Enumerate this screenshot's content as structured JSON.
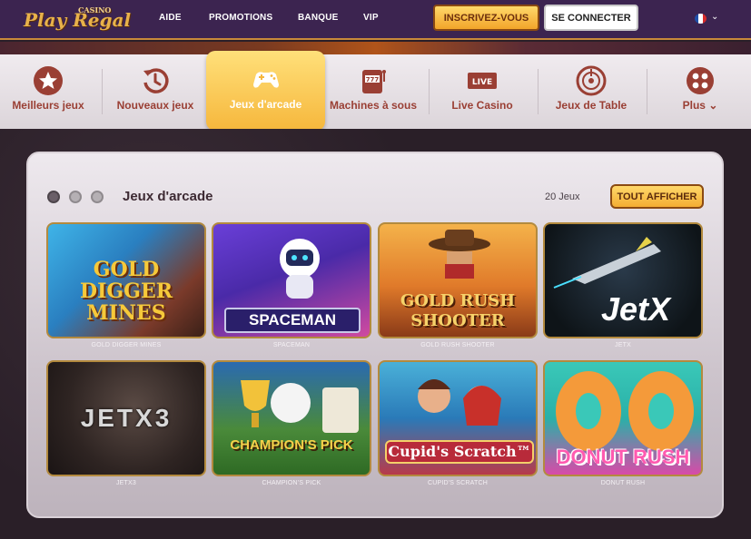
{
  "header": {
    "logo_text": "Play Regal",
    "logo_sub": "CASINO",
    "nav": [
      "AIDE",
      "PROMOTIONS",
      "BANQUE",
      "VIP"
    ],
    "signup_label": "INSCRIVEZ-VOUS",
    "login_label": "SE CONNECTER",
    "language_icon": "france-flag-icon"
  },
  "categories": [
    {
      "label": "Meilleurs jeux",
      "icon": "star-icon"
    },
    {
      "label": "Nouveaux jeux",
      "icon": "history-icon"
    },
    {
      "label": "Jeux d'arcade",
      "icon": "gamepad-icon",
      "active": true
    },
    {
      "label": "Machines à sous",
      "icon": "slot-machine-icon"
    },
    {
      "label": "Live Casino",
      "icon": "live-icon",
      "badge": "LIVE"
    },
    {
      "label": "Jeux de Table",
      "icon": "roulette-icon"
    },
    {
      "label": "Plus",
      "icon": "grid-icon"
    }
  ],
  "section": {
    "title": "Jeux d'arcade",
    "count": "20 Jeux",
    "show_all_label": "TOUT AFFICHER",
    "games": [
      {
        "name": "GOLD DIGGER MINES",
        "art_title": "GOLD DIGGER MINES"
      },
      {
        "name": "SPACEMAN",
        "art_title": "SPACEMAN"
      },
      {
        "name": "GOLD RUSH SHOOTER",
        "art_title": "GOLD RUSH SHOOTER"
      },
      {
        "name": "JETX",
        "art_title": "JetX"
      },
      {
        "name": "JETX3",
        "art_title": "JETX3"
      },
      {
        "name": "CHAMPION'S PICK",
        "art_title": "CHAMPION'S PICK"
      },
      {
        "name": "CUPID'S SCRATCH",
        "art_title": "Cupid's Scratch™"
      },
      {
        "name": "DONUT RUSH",
        "art_title": "DONUT RUSH"
      }
    ]
  },
  "colors": {
    "header_bg": "#3c2450",
    "accent_gold": "#f6b73c",
    "category_label": "#9a3f34"
  }
}
